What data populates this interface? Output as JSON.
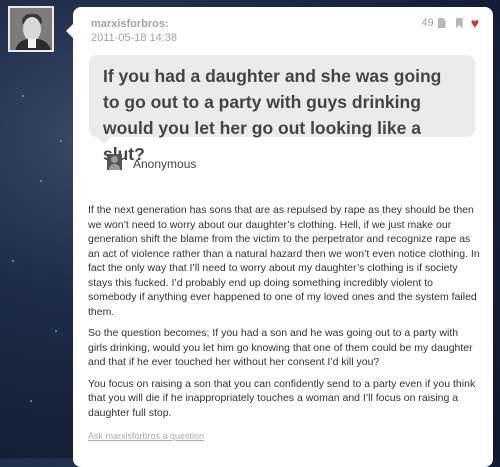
{
  "post": {
    "username": "marxisforbros:",
    "timestamp": "2011-05-18 14:38",
    "note_count": "49",
    "note_icon": "note-icon",
    "bookmark_icon": "bookmark-icon",
    "like_icon": "heart-icon",
    "like_color": "#d9312b"
  },
  "question": {
    "text": "If you had a daughter and she was going to go out to a party with guys drinking would you let her go out looking like a slut?",
    "asker": "Anonymous"
  },
  "answer": {
    "paragraphs": [
      "If the next generation has sons that are as repulsed by rape as they should be then we won’t need to worry about our daughter’s clothing. Hell, if we just make our generation shift the blame from the victim to the perpetrator and recognize rape as an act of violence rather than a natural hazard then we won’t even notice clothing. In fact the only way that I’ll need to worry about my daughter’s clothing is if society stays this fucked. I’d probably end up doing something incredibly violent to somebody if anything ever happened to one of my loved ones and the system failed them.",
      "So the question becomes; If you had a son and he was going out to a party with girls drinking, would you let him go knowing that one of them could be my daughter and that if he ever touched her without her consent I’d kill you?",
      "You focus on raising a son that you can confidently send to a party even if you think that you will die if he inappropriately touches a woman and I’ll focus on raising a daughter full stop."
    ]
  },
  "footer": {
    "ask_link": "Ask marxisforbros a question"
  }
}
